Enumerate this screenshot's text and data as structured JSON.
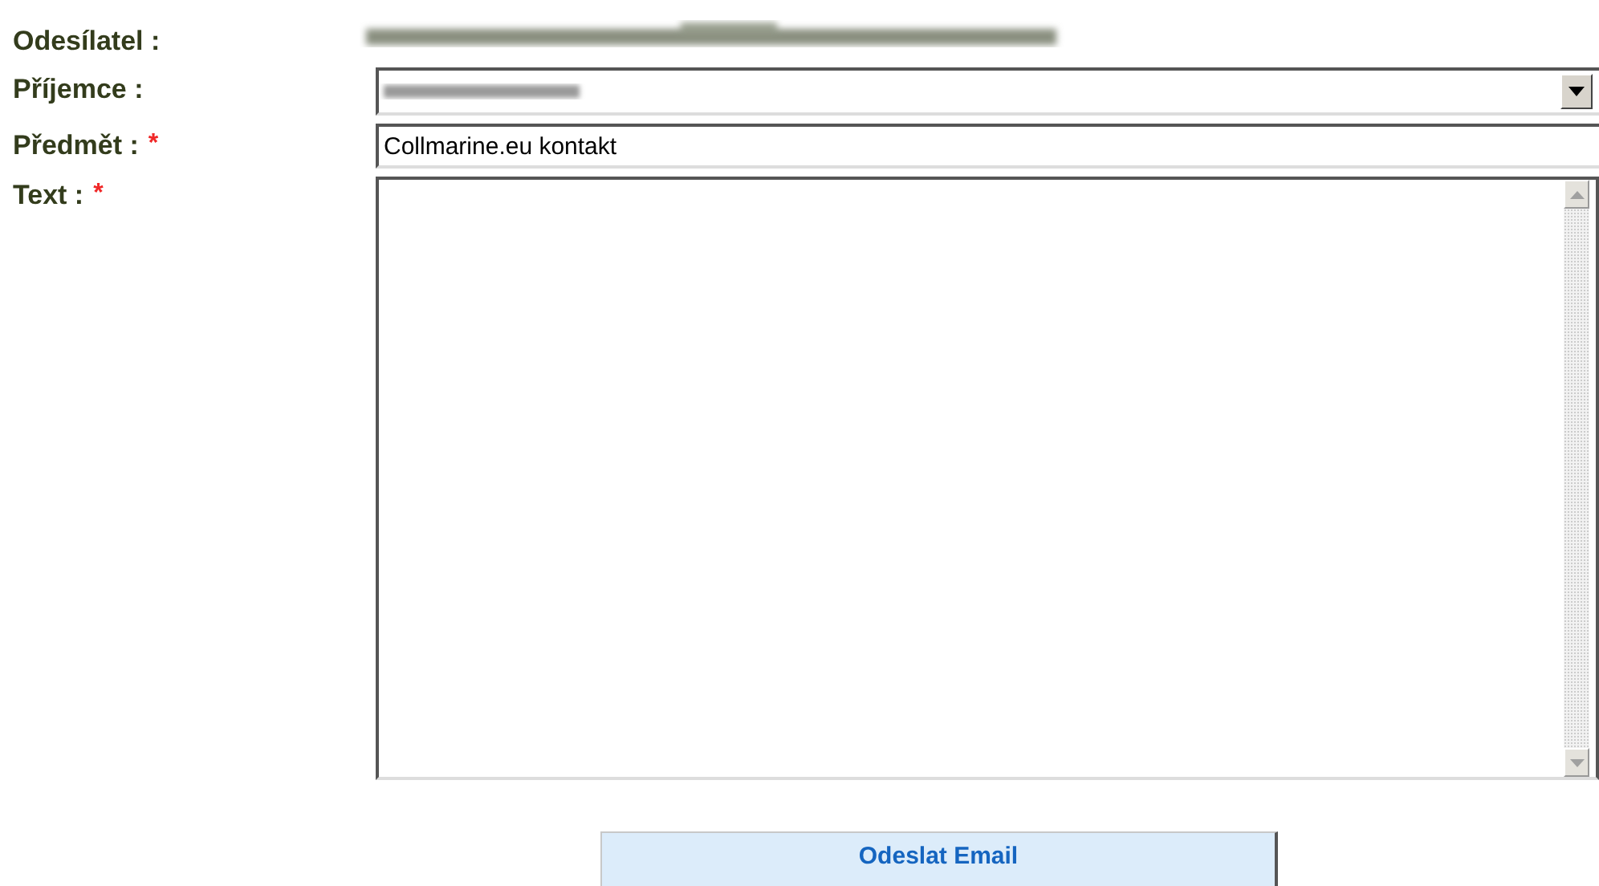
{
  "form": {
    "fields": [
      {
        "kind": "static",
        "label": "Odesílatel :",
        "blurred": true
      },
      {
        "kind": "select",
        "label": "Příjemce :",
        "blurred": true
      },
      {
        "kind": "input",
        "label": "Předmět :",
        "required_mark": "*",
        "value": "Collmarine.eu kontakt"
      },
      {
        "kind": "textarea",
        "label": "Text :",
        "required_mark": "*"
      }
    ],
    "submit": {
      "label": "Odeslat Email"
    }
  }
}
